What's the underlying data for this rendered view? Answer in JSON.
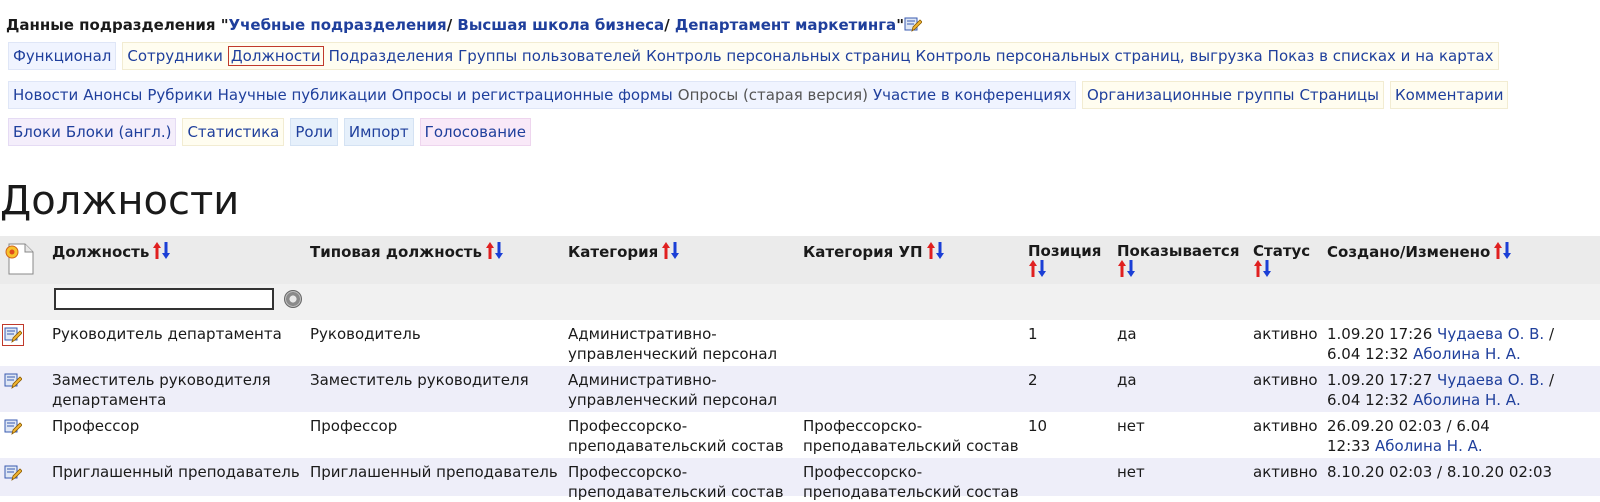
{
  "header": {
    "prefix": "Данные подразделения \"",
    "path": [
      {
        "label": "Учебные подразделения"
      },
      {
        "label": "Высшая школа бизнеса"
      },
      {
        "label": "Департамент маркетинга"
      }
    ],
    "separator": "/ ",
    "suffix": "\""
  },
  "nav": {
    "rows": [
      [
        {
          "items": [
            "Функционал"
          ]
        },
        {
          "items": [
            "Сотрудники",
            "Должности",
            "Подразделения",
            "Группы пользователей",
            "Контроль персональных страниц",
            "Контроль персональных страниц, выгрузка",
            "Показ в списках и на картах"
          ]
        }
      ],
      [
        {
          "items": [
            "Новости",
            "Анонсы",
            "Рубрики",
            "Научные публикации",
            "Опросы и регистрационные формы",
            "Опросы (старая версия)",
            "Участие в конференциях"
          ]
        },
        {
          "items": [
            "Организационные группы",
            "Страницы"
          ]
        },
        {
          "items": [
            "Комментарии"
          ]
        }
      ],
      [
        {
          "items": [
            "Блоки",
            "Блоки (англ.)"
          ]
        },
        {
          "items": [
            "Статистика"
          ]
        },
        {
          "items": [
            "Роли"
          ]
        },
        {
          "items": [
            "Импорт"
          ]
        },
        {
          "items": [
            "Голосование"
          ]
        }
      ]
    ],
    "active": "Должности",
    "plain": "Опросы (старая версия)"
  },
  "page_title": "Должности",
  "table": {
    "columns": [
      {
        "label": "Должность"
      },
      {
        "label": "Типовая должность"
      },
      {
        "label": "Категория"
      },
      {
        "label": "Категория УП"
      },
      {
        "label": "Позиция"
      },
      {
        "label": "Показывается"
      },
      {
        "label": "Статус"
      },
      {
        "label": "Создано/Изменено"
      }
    ],
    "filter_value": "",
    "rows": [
      {
        "position": "Руководитель департамента",
        "typical": "Руководитель",
        "category": [
          "Административно-",
          "управленческий персонал"
        ],
        "category_up": [],
        "order": "1",
        "shown": "да",
        "status": "активно",
        "changed": [
          [
            {
              "t": "1.09.20 17:26 "
            },
            {
              "t": "Чудаева О. В.",
              "link": true
            },
            {
              "t": " /"
            }
          ],
          [
            {
              "t": "6.04 12:32 "
            },
            {
              "t": "Аболина Н. А.",
              "link": true
            }
          ]
        ]
      },
      {
        "position": [
          "Заместитель руководителя",
          "департамента"
        ],
        "typical": "Заместитель руководителя",
        "category": [
          "Административно-",
          "управленческий персонал"
        ],
        "category_up": [],
        "order": "2",
        "shown": "да",
        "status": "активно",
        "changed": [
          [
            {
              "t": "1.09.20 17:27 "
            },
            {
              "t": "Чудаева О. В.",
              "link": true
            },
            {
              "t": " /"
            }
          ],
          [
            {
              "t": "6.04 12:32 "
            },
            {
              "t": "Аболина Н. А.",
              "link": true
            }
          ]
        ]
      },
      {
        "position": "Профессор",
        "typical": "Профессор",
        "category": [
          "Профессорско-",
          "преподавательский состав"
        ],
        "category_up": [
          "Профессорско-",
          "преподавательский состав"
        ],
        "order": "10",
        "shown": "нет",
        "status": "активно",
        "changed": [
          [
            {
              "t": "26.09.20 02:03 / 6.04"
            }
          ],
          [
            {
              "t": "12:33 "
            },
            {
              "t": "Аболина Н. А.",
              "link": true
            }
          ]
        ]
      },
      {
        "position": "Приглашенный преподаватель",
        "typical": "Приглашенный преподаватель",
        "category": [
          "Профессорско-",
          "преподавательский состав"
        ],
        "category_up": [
          "Профессорско-",
          "преподавательский состав"
        ],
        "order": "",
        "shown": "нет",
        "status": "активно",
        "changed": [
          [
            {
              "t": "8.10.20 02:03 / 8.10.20 02:03"
            }
          ]
        ]
      }
    ]
  },
  "colors": {
    "link": "#1f3f9c",
    "active_border": "#c0392b",
    "sort_up": "#e02020",
    "sort_down": "#1b3fd6",
    "alt_row": "#eeeef9",
    "header_bg": "#ebebeb"
  },
  "icons": {
    "edit": "pencil-edit-icon",
    "new": "new-document-icon",
    "sort": "sort-arrows-icon",
    "filter": "filter-apply-icon"
  }
}
